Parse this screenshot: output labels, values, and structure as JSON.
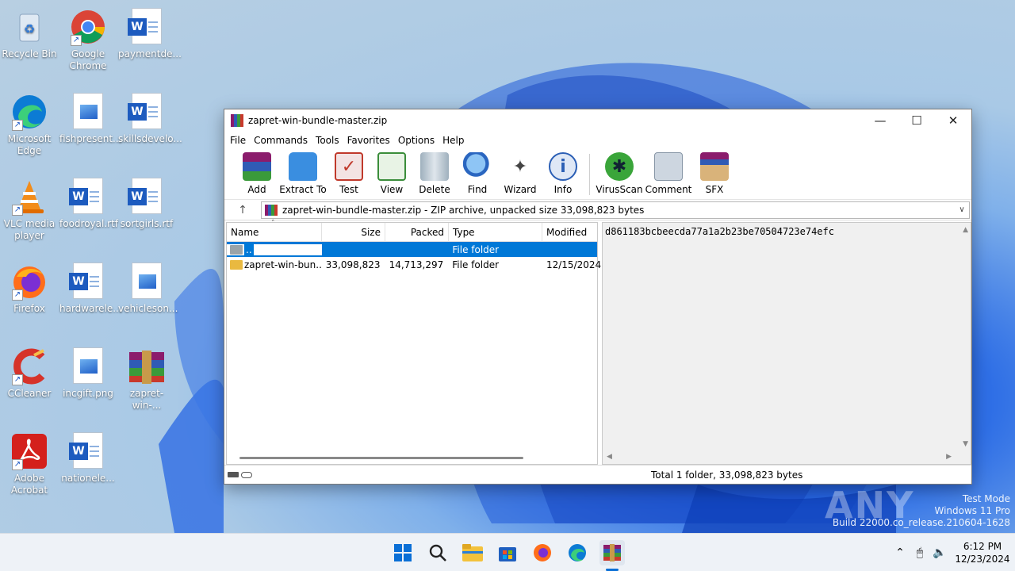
{
  "desktop": {
    "icons": [
      {
        "label1": "Recycle Bin",
        "label2": ""
      },
      {
        "label1": "Google",
        "label2": "Chrome"
      },
      {
        "label1": "paymentde...",
        "label2": ""
      },
      {
        "label1": "Microsoft",
        "label2": "Edge"
      },
      {
        "label1": "fishpresent...",
        "label2": ""
      },
      {
        "label1": "skillsdevelo...",
        "label2": ""
      },
      {
        "label1": "VLC media",
        "label2": "player"
      },
      {
        "label1": "foodroyal.rtf",
        "label2": ""
      },
      {
        "label1": "sortgirls.rtf",
        "label2": ""
      },
      {
        "label1": "Firefox",
        "label2": ""
      },
      {
        "label1": "hardwarele...",
        "label2": ""
      },
      {
        "label1": "vehicleson...",
        "label2": ""
      },
      {
        "label1": "CCleaner",
        "label2": ""
      },
      {
        "label1": "incgift.png",
        "label2": ""
      },
      {
        "label1": "zapret-win-...",
        "label2": ""
      },
      {
        "label1": "Adobe",
        "label2": "Acrobat"
      },
      {
        "label1": "nationele...",
        "label2": ""
      }
    ]
  },
  "window": {
    "title": "zapret-win-bundle-master.zip",
    "menu": [
      "File",
      "Commands",
      "Tools",
      "Favorites",
      "Options",
      "Help"
    ],
    "toolbar": [
      {
        "label": "Add",
        "icon": "add-icon"
      },
      {
        "label": "Extract To",
        "icon": "extract-icon"
      },
      {
        "label": "Test",
        "icon": "test-icon"
      },
      {
        "label": "View",
        "icon": "view-icon"
      },
      {
        "label": "Delete",
        "icon": "delete-icon"
      },
      {
        "label": "Find",
        "icon": "find-icon"
      },
      {
        "label": "Wizard",
        "icon": "wizard-icon"
      },
      {
        "label": "Info",
        "icon": "info-icon"
      },
      {
        "label": "VirusScan",
        "icon": "virusscan-icon"
      },
      {
        "label": "Comment",
        "icon": "comment-icon"
      },
      {
        "label": "SFX",
        "icon": "sfx-icon"
      }
    ],
    "address": "zapret-win-bundle-master.zip - ZIP archive, unpacked size 33,098,823 bytes",
    "columns": {
      "name": "Name",
      "size": "Size",
      "packed": "Packed",
      "type": "Type",
      "modified": "Modified"
    },
    "rows": [
      {
        "name": "..",
        "size": "",
        "packed": "",
        "type": "File folder",
        "modified": "",
        "selected": true
      },
      {
        "name": "zapret-win-bun...",
        "size": "33,098,823",
        "packed": "14,713,297",
        "type": "File folder",
        "modified": "12/15/2024",
        "selected": false
      }
    ],
    "comment_text": "d861183bcbeecda77a1a2b23be70504723e74efc",
    "status_right": "Total 1 folder, 33,098,823 bytes"
  },
  "taskbar": {
    "time": "6:12 PM",
    "date": "12/23/2024"
  },
  "watermark": {
    "line1": "Test Mode",
    "line2": "Windows 11 Pro",
    "line3": "Build 22000.co_release.210604-1628",
    "brand": "ANY RUN"
  }
}
